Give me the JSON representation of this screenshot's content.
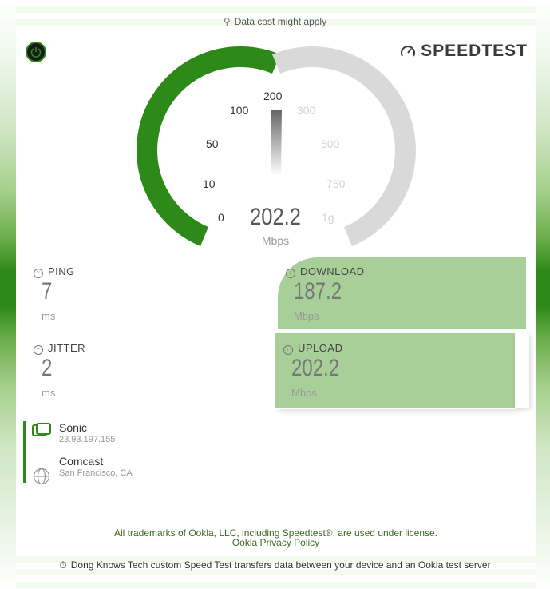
{
  "top_note": {
    "icon": "antenna-icon",
    "text": "Data cost might apply"
  },
  "brand": {
    "name": "SPEEDTEST",
    "icon": "speedometer-icon"
  },
  "gauge": {
    "value": "202.2",
    "unit": "Mbps",
    "ticks": [
      "0",
      "10",
      "50",
      "100",
      "200",
      "300",
      "500",
      "750",
      "1g"
    ],
    "active_color": "#2e8a18",
    "inactive_color": "#d9d9d9"
  },
  "metrics": {
    "ping": {
      "label": "PING",
      "value": "7",
      "unit": "ms"
    },
    "jitter": {
      "label": "JITTER",
      "value": "2",
      "unit": "ms"
    },
    "download": {
      "label": "DOWNLOAD",
      "value": "187.2",
      "unit": "Mbps"
    },
    "upload": {
      "label": "UPLOAD",
      "value": "202.2",
      "unit": "Mbps"
    }
  },
  "isp": {
    "name": "Sonic",
    "ip": "23.93.197.155"
  },
  "server": {
    "name": "Comcast",
    "location": "San Francisco, CA"
  },
  "footer": {
    "trademark": "All trademarks of Ookla, LLC, including Speedtest®, are used under license.",
    "privacy": "Ookla Privacy Policy"
  },
  "bottom_note": {
    "icon": "stopwatch-icon",
    "text": "Dong Knows Tech custom Speed Test transfers data between your device and an Ookla test server"
  },
  "colors": {
    "accent": "#2e8a18",
    "panel": "#a8cf98"
  }
}
